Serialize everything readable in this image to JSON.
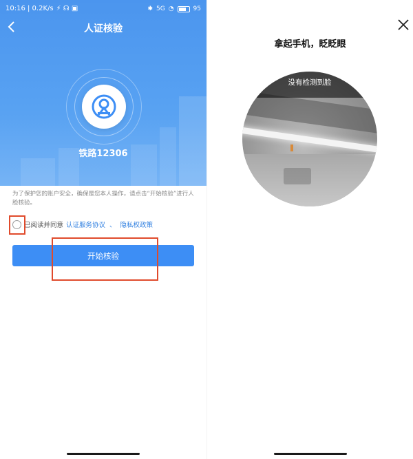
{
  "left": {
    "status_bar": {
      "time_speed": "10:16 | 0.2K/s",
      "signal": "5G",
      "battery": "95"
    },
    "nav": {
      "back_icon": "chevron-left-icon",
      "title": "人证核验"
    },
    "brand": {
      "logo_icon": "railway-logo-icon",
      "name": "铁路12306"
    },
    "notice": "为了保护您的账户安全，确保是您本人操作，请点击“开始核验”进行人脸核验。",
    "agreement": {
      "prefix": "已阅读并同意",
      "link1": "认证服务协议",
      "separator": "、",
      "link2": "隐私权政策"
    },
    "start_button": "开始核验"
  },
  "right": {
    "close_icon": "close-icon",
    "title": "拿起手机，眨眨眼",
    "camera_hint": "没有检测到脸"
  },
  "colors": {
    "primary_blue": "#3d8ef5",
    "hero_blue": "#4b95ee",
    "link_blue": "#2f7fe0",
    "highlight_red": "#e04a2b"
  }
}
